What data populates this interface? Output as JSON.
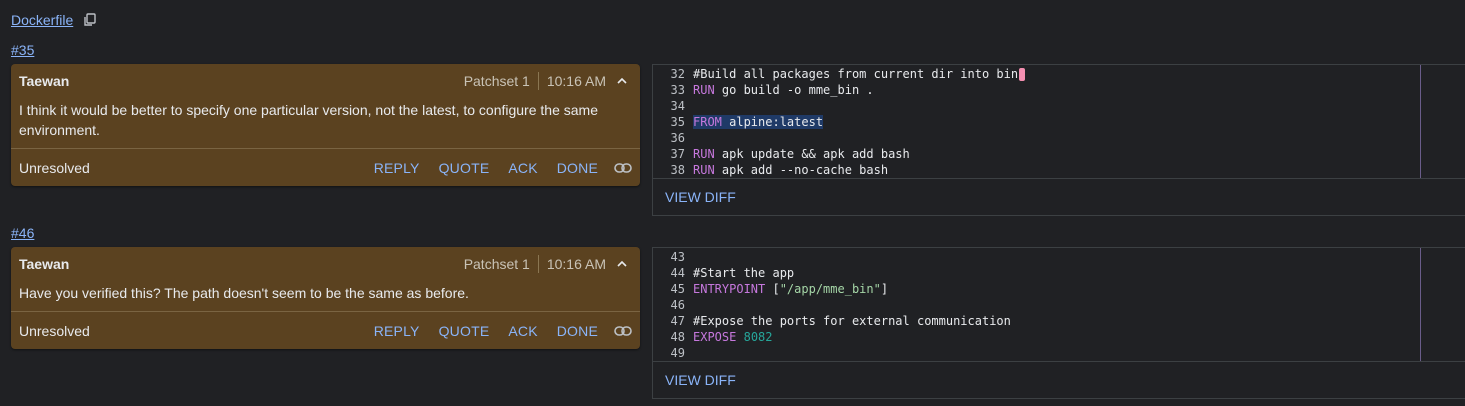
{
  "file": {
    "name": "Dockerfile"
  },
  "threads": [
    {
      "id": "#35",
      "author": "Taewan",
      "patchset": "Patchset 1",
      "time": "10:16 AM",
      "body": "I think it would be better to specify one particular version, not the latest, to configure the same environment.",
      "status": "Unresolved",
      "actions": {
        "reply": "REPLY",
        "quote": "QUOTE",
        "ack": "ACK",
        "done": "DONE"
      },
      "view_diff": "VIEW DIFF",
      "lines": [
        {
          "n": "32",
          "pre": "",
          "kw": "",
          "rest": "#Build all packages from current dir into bin"
        },
        {
          "n": "33",
          "kw": "RUN",
          "rest": " go build -o mme_bin ."
        },
        {
          "n": "34",
          "kw": "",
          "rest": ""
        },
        {
          "n": "35",
          "kw": "FROM",
          "rest": " alpine:latest"
        },
        {
          "n": "36",
          "kw": "",
          "rest": ""
        },
        {
          "n": "37",
          "kw": "RUN",
          "rest": " apk update && apk add bash"
        },
        {
          "n": "38",
          "kw": "RUN",
          "rest": " apk add --no-cache bash"
        }
      ]
    },
    {
      "id": "#46",
      "author": "Taewan",
      "patchset": "Patchset 1",
      "time": "10:16 AM",
      "body": "Have you verified this? The path doesn't seem to be the same as before.",
      "status": "Unresolved",
      "actions": {
        "reply": "REPLY",
        "quote": "QUOTE",
        "ack": "ACK",
        "done": "DONE"
      },
      "view_diff": "VIEW DIFF",
      "lines": [
        {
          "n": "43",
          "kw": "",
          "rest": ""
        },
        {
          "n": "44",
          "kw": "",
          "rest": "#Start the app"
        },
        {
          "n": "45",
          "kw": "ENTRYPOINT",
          "rest": " [",
          "str": "\"/app/mme_bin\"",
          "post": "]"
        },
        {
          "n": "46",
          "kw": "",
          "rest": ""
        },
        {
          "n": "47",
          "kw": "",
          "rest": "#Expose the ports for external communication"
        },
        {
          "n": "48",
          "kw": "EXPOSE",
          "rest": " ",
          "num": "8082"
        },
        {
          "n": "49",
          "kw": "",
          "rest": ""
        }
      ]
    }
  ],
  "colors": {
    "comment_bg": "#5b4220",
    "link": "#8ab4f8",
    "keyword": "#c678dd",
    "highlight": "#1f3a67"
  }
}
